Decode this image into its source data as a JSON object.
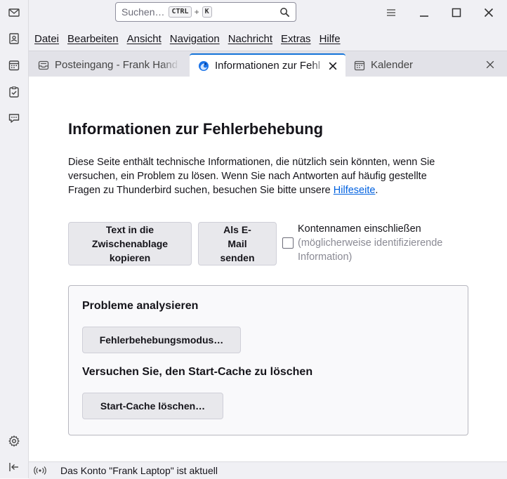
{
  "spaces": {
    "items": [
      {
        "name": "mail-icon"
      },
      {
        "name": "address-book-icon"
      },
      {
        "name": "calendar-icon"
      },
      {
        "name": "tasks-icon"
      },
      {
        "name": "chat-icon"
      }
    ],
    "settings_icon": "gear-icon",
    "collapse_icon": "collapse-left-icon"
  },
  "titlebar": {
    "search_placeholder": "Suchen…",
    "shortcut_key1": "CTRL",
    "shortcut_plus": "+",
    "shortcut_key2": "K"
  },
  "menubar": {
    "items": [
      "Datei",
      "Bearbeiten",
      "Ansicht",
      "Navigation",
      "Nachricht",
      "Extras",
      "Hilfe"
    ]
  },
  "tabs": [
    {
      "label": "Posteingang - Frank Hand",
      "icon": "inbox-icon",
      "active": false
    },
    {
      "label": "Informationen zur Fehl",
      "icon": "thunderbird-icon",
      "active": true
    },
    {
      "label": "Kalender",
      "icon": "calendar-icon",
      "active": false
    }
  ],
  "page": {
    "title": "Informationen zur Fehlerbehebung",
    "intro_text": "Diese Seite enthält technische Informationen, die nützlich sein könnten, wenn Sie versuchen, ein Problem zu lösen. Wenn Sie nach Antworten auf häufig gestellte Fragen zu Thunderbird suchen, besuchen Sie bitte unsere ",
    "intro_link": "Hilfeseite",
    "intro_end": ".",
    "copy_button": "Text in die Zwischenablage kopieren",
    "email_button": "Als E-Mail senden",
    "checkbox_label": "Kontennamen einschließen",
    "checkbox_hint": "(möglicherweise identifizierende Information)",
    "checkbox_checked": false,
    "analyze_heading": "Probleme analysieren",
    "troubleshoot_button": "Fehlerbehebungsmodus…",
    "cache_heading": "Versuchen Sie, den Start-Cache zu löschen",
    "cache_button": "Start-Cache löschen…"
  },
  "statusbar": {
    "text": "Das Konto \"Frank Laptop\" ist aktuell"
  },
  "colors": {
    "accent": "#1373d9",
    "link": "#0061e0"
  }
}
